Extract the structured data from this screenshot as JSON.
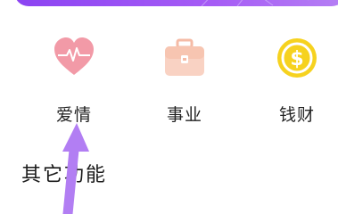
{
  "features": [
    {
      "label": "爱情",
      "icon": "heart-icon",
      "color": "#f29aa7"
    },
    {
      "label": "事业",
      "icon": "briefcase-icon",
      "color": "#f7cab6"
    },
    {
      "label": "钱财",
      "icon": "coin-icon",
      "color": "#f6d21f"
    }
  ],
  "section": {
    "title": "其它功能"
  },
  "colors": {
    "banner": "#9b4ff4",
    "arrow": "#b27ef3"
  }
}
